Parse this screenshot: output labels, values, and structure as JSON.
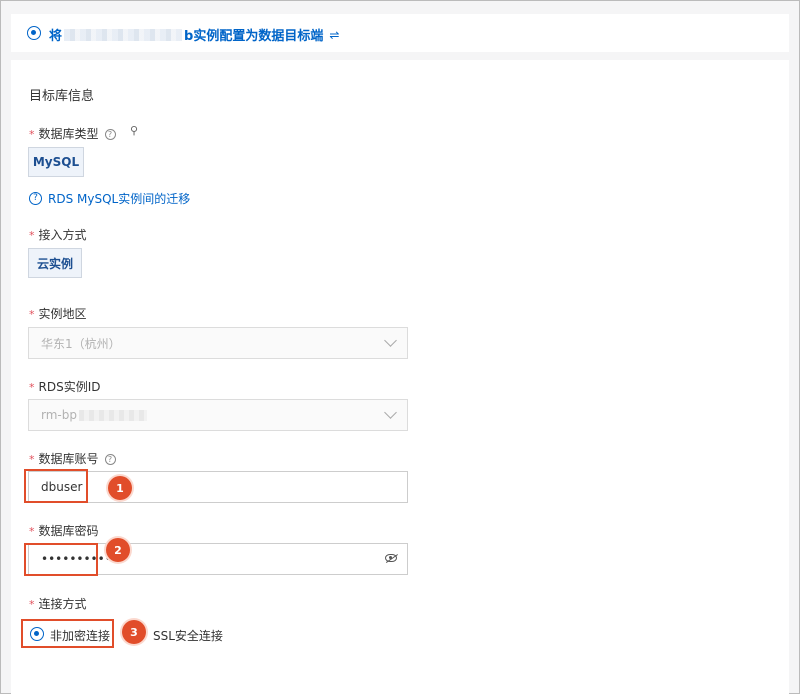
{
  "header": {
    "title_prefix": "将",
    "title_suffix": "b实例配置为数据目标端",
    "swap_glyph": "⇌"
  },
  "section": {
    "title": "目标库信息"
  },
  "db_type": {
    "label": "数据库类型",
    "value": "MySQL"
  },
  "migration_link": {
    "text": "RDS MySQL实例间的迁移"
  },
  "access": {
    "label": "接入方式",
    "value": "云实例"
  },
  "region": {
    "label": "实例地区",
    "value": "华东1（杭州）"
  },
  "instance": {
    "label": "RDS实例ID",
    "value_prefix": "rm-bp"
  },
  "account": {
    "label": "数据库账号",
    "value": "dbuser",
    "badge": "1"
  },
  "password": {
    "label": "数据库密码",
    "value": "•••••••••••",
    "badge": "2"
  },
  "connection": {
    "label": "连接方式",
    "options": [
      "非加密连接",
      "SSL安全连接"
    ],
    "selected": "非加密连接",
    "badge": "3"
  },
  "required_mark": "*",
  "help_glyph": "?",
  "search_glyph": "⚲"
}
